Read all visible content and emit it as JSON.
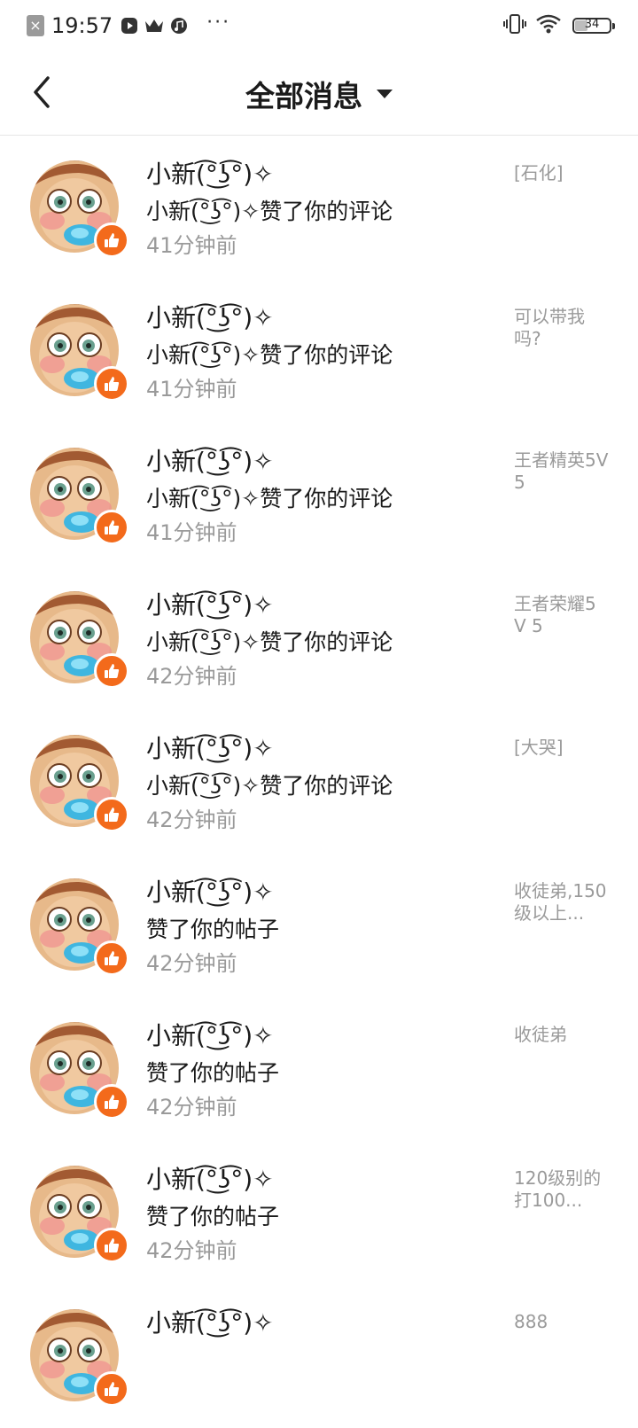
{
  "status_bar": {
    "time": "19:57",
    "battery": "34",
    "battery_level": 0.34,
    "icons": [
      "notification-x-icon",
      "video-icon",
      "crown-icon",
      "music-icon",
      "more-dots-icon",
      "vibrate-icon",
      "wifi-icon",
      "battery-icon"
    ]
  },
  "header": {
    "title": "全部消息",
    "back_icon": "back-chevron-icon",
    "dropdown_icon": "caret-down-icon"
  },
  "colors": {
    "like_badge": "#f36a1b",
    "muted_text": "#9a9a9a",
    "divider": "#e6e6e6"
  },
  "notifications": [
    {
      "name": "小新(͡°͜ʖ͡°)✧",
      "message": "小新(͡°͜ʖ͡°)✧赞了你的评论",
      "time": "41分钟前",
      "preview": "[石化]"
    },
    {
      "name": "小新(͡°͜ʖ͡°)✧",
      "message": "小新(͡°͜ʖ͡°)✧赞了你的评论",
      "time": "41分钟前",
      "preview": "可以带我吗?"
    },
    {
      "name": "小新(͡°͜ʖ͡°)✧",
      "message": "小新(͡°͜ʖ͡°)✧赞了你的评论",
      "time": "41分钟前",
      "preview": "王者精英5V5"
    },
    {
      "name": "小新(͡°͜ʖ͡°)✧",
      "message": "小新(͡°͜ʖ͡°)✧赞了你的评论",
      "time": "42分钟前",
      "preview": "王者荣耀5 V 5"
    },
    {
      "name": "小新(͡°͜ʖ͡°)✧",
      "message": "小新(͡°͜ʖ͡°)✧赞了你的评论",
      "time": "42分钟前",
      "preview": "[大哭]"
    },
    {
      "name": "小新(͡°͜ʖ͡°)✧",
      "message": "赞了你的帖子",
      "time": "42分钟前",
      "preview": "收徒弟,150级以上..."
    },
    {
      "name": "小新(͡°͜ʖ͡°)✧",
      "message": "赞了你的帖子",
      "time": "42分钟前",
      "preview": "收徒弟"
    },
    {
      "name": "小新(͡°͜ʖ͡°)✧",
      "message": "赞了你的帖子",
      "time": "42分钟前",
      "preview": "120级别的打100..."
    },
    {
      "name": "小新(͡°͜ʖ͡°)✧",
      "message": "",
      "time": "",
      "preview": "888"
    }
  ]
}
